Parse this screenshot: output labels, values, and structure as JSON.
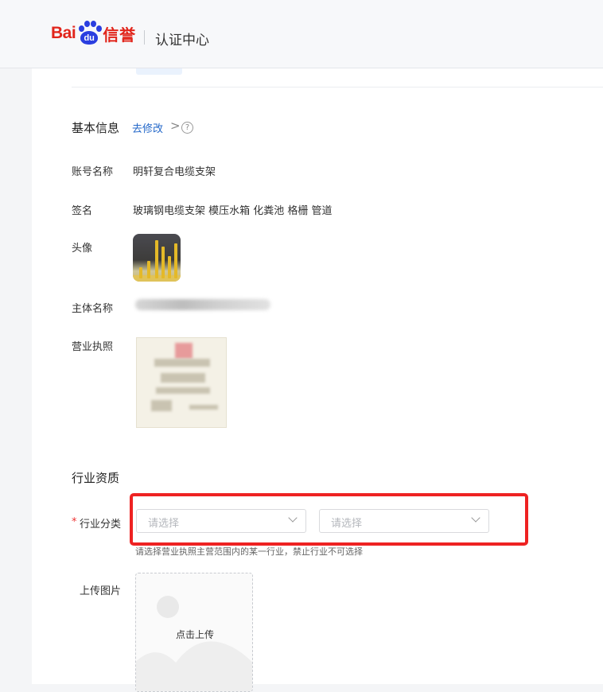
{
  "header": {
    "logo_text": "Bai",
    "logo_du": "du",
    "logo_xinyu": "信誉",
    "title": "认证中心"
  },
  "basic_info": {
    "title": "基本信息",
    "edit_link": "去修改",
    "chevron": ">",
    "help": "?",
    "account_label": "账号名称",
    "account_value": "明轩复合电缆支架",
    "signature_label": "签名",
    "signature_value": "玻璃钢电缆支架 模压水箱 化粪池 格栅 管道",
    "avatar_label": "头像",
    "entity_label": "主体名称",
    "license_label": "营业执照"
  },
  "industry": {
    "title": "行业资质",
    "required_mark": "*",
    "category_label": "行业分类",
    "select1_placeholder": "请选择",
    "select2_placeholder": "请选择",
    "helper_text": "请选择营业执照主营范围内的某一行业，禁止行业不可选择",
    "upload_label": "上传图片",
    "upload_text": "点击上传"
  },
  "colors": {
    "brand_red": "#e1251b",
    "brand_blue": "#2a3ee0",
    "link": "#2468c9",
    "highlight_box": "#ee2222"
  }
}
